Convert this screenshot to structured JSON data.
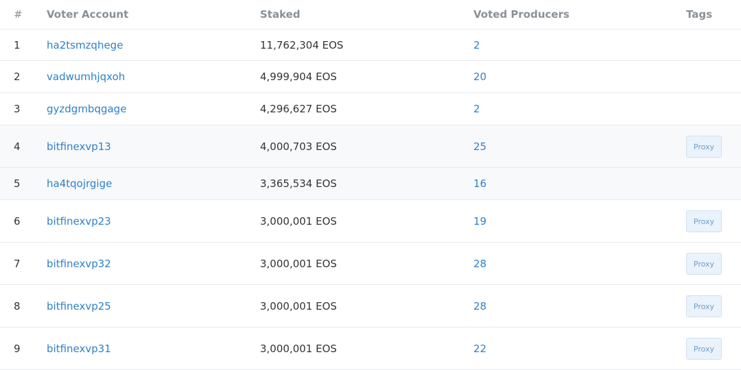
{
  "table": {
    "headers": {
      "rank": "#",
      "account": "Voter Account",
      "staked": "Staked",
      "voted": "Voted Producers",
      "tags": "Tags"
    },
    "rows": [
      {
        "rank": "1",
        "account": "ha2tsmzqhege",
        "staked": "11,762,304 EOS",
        "voted": "2",
        "tag": ""
      },
      {
        "rank": "2",
        "account": "vadwumhjqxoh",
        "staked": "4,999,904 EOS",
        "voted": "20",
        "tag": ""
      },
      {
        "rank": "3",
        "account": "gyzdgmbqgage",
        "staked": "4,296,627 EOS",
        "voted": "2",
        "tag": ""
      },
      {
        "rank": "4",
        "account": "bitfinexvp13",
        "staked": "4,000,703 EOS",
        "voted": "25",
        "tag": "Proxy"
      },
      {
        "rank": "5",
        "account": "ha4tqojrgige",
        "staked": "3,365,534 EOS",
        "voted": "16",
        "tag": ""
      },
      {
        "rank": "6",
        "account": "bitfinexvp23",
        "staked": "3,000,001 EOS",
        "voted": "19",
        "tag": "Proxy"
      },
      {
        "rank": "7",
        "account": "bitfinexvp32",
        "staked": "3,000,001 EOS",
        "voted": "28",
        "tag": "Proxy"
      },
      {
        "rank": "8",
        "account": "bitfinexvp25",
        "staked": "3,000,001 EOS",
        "voted": "28",
        "tag": "Proxy"
      },
      {
        "rank": "9",
        "account": "bitfinexvp31",
        "staked": "3,000,001 EOS",
        "voted": "22",
        "tag": "Proxy"
      }
    ]
  },
  "colors": {
    "link": "#2f80c9",
    "header_text": "#8a9097",
    "proxy_badge_bg": "#eaf2fb",
    "row_highlight": "#f8f9fb"
  }
}
